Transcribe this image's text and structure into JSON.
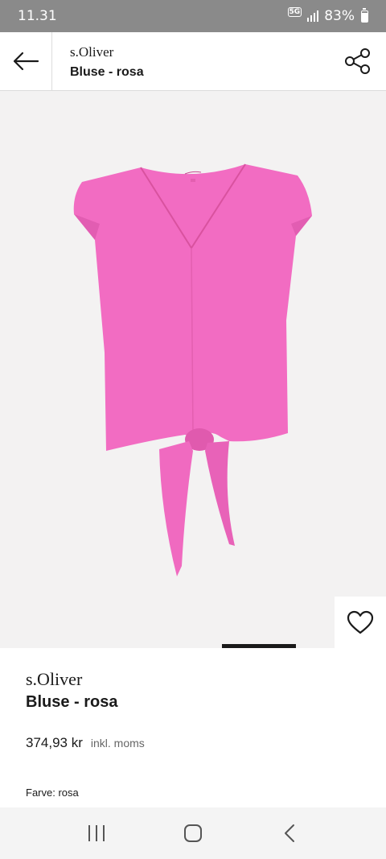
{
  "status_bar": {
    "time": "11.31",
    "network": "5G",
    "battery": "83%",
    "battery_level": 0.83
  },
  "header": {
    "brand": "s.Oliver",
    "product_name": "Bluse - rosa",
    "back_icon": "arrow-left-icon",
    "share_icon": "share-icon"
  },
  "gallery": {
    "image": "pink-blouse-product-photo",
    "wishlist_icon": "heart-outline-icon",
    "colors": {
      "background": "#f3f2f2",
      "product": "#f06cc0",
      "indicator": "#1a1a1a"
    }
  },
  "product": {
    "brand": "s.Oliver",
    "name": "Bluse - rosa",
    "price": "374,93 kr",
    "vat_note": "inkl. moms",
    "color_label": "Farve:",
    "color_value": "rosa"
  },
  "nav_bar": {
    "recents_icon": "recents-icon",
    "home_icon": "home-icon",
    "back_icon": "back-chevron-icon"
  }
}
